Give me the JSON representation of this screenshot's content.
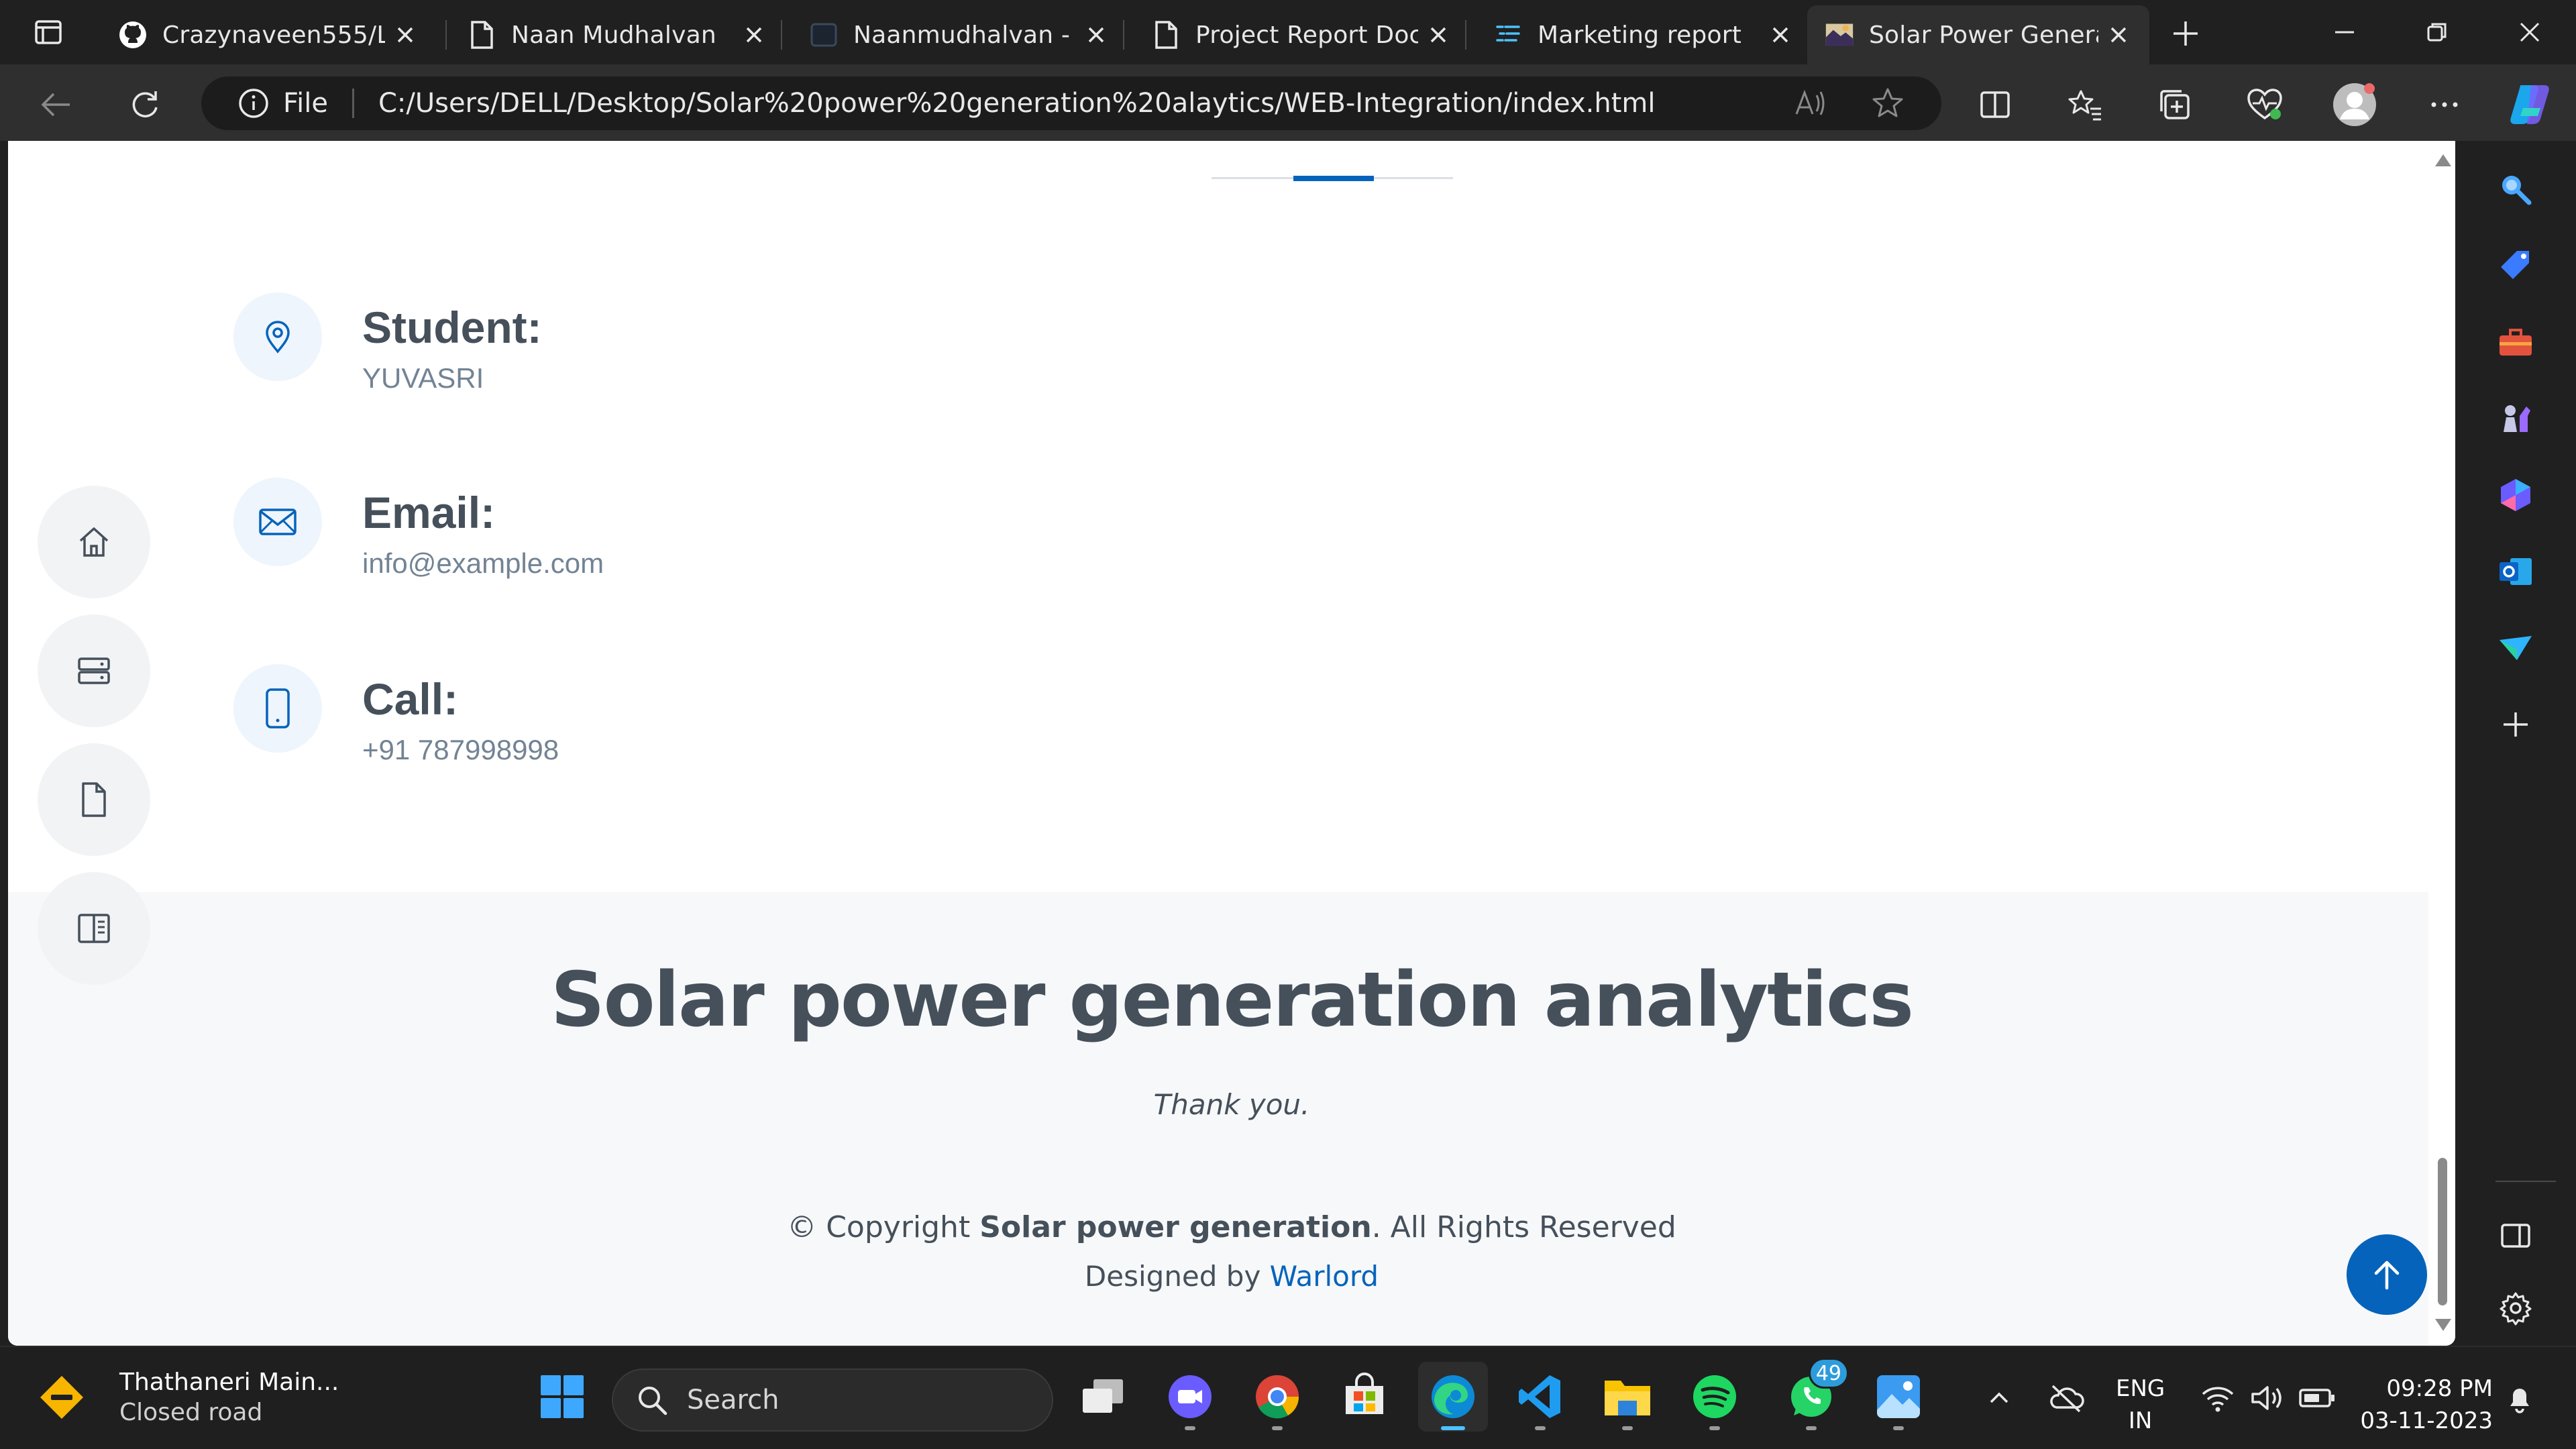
{
  "browser": {
    "tabs": [
      {
        "title": "Crazynaveen555/Le",
        "icon": "github-icon",
        "active": false
      },
      {
        "title": "Naan Mudhalvan",
        "icon": "page-icon",
        "active": false
      },
      {
        "title": "Naanmudhalvan - S",
        "icon": "screen-icon",
        "active": false
      },
      {
        "title": "Project Report Docu",
        "icon": "page-icon",
        "active": false
      },
      {
        "title": "Marketing report",
        "icon": "list-icon",
        "active": false
      },
      {
        "title": "Solar Power Genera",
        "icon": "solar-favicon",
        "active": true
      }
    ],
    "address": {
      "scheme": "File",
      "url": "C:/Users/DELL/Desktop/Solar%20power%20generation%20alaytics/WEB-Integration/index.html"
    }
  },
  "page": {
    "contact": [
      {
        "label": "Student:",
        "value": "YUVASRI",
        "icon": "location-pin-icon"
      },
      {
        "label": "Email:",
        "value": "info@example.com",
        "icon": "envelope-icon"
      },
      {
        "label": "Call:",
        "value": "+91 787998998",
        "icon": "phone-icon"
      }
    ],
    "sidenav": [
      "home-icon",
      "server-icon",
      "file-icon",
      "book-icon"
    ],
    "footer": {
      "title": "Solar power generation analytics",
      "thanks": "Thank you.",
      "copyright_prefix": "© Copyright ",
      "copyright_brand": "Solar power generation",
      "copyright_suffix": ". All Rights Reserved",
      "designed_by": "Designed by ",
      "designer": "Warlord"
    }
  },
  "taskbar": {
    "weather_title": "Thathaneri Main...",
    "weather_sub": "Closed road",
    "search_placeholder": "Search",
    "whatsapp_badge": "49",
    "language_top": "ENG",
    "language_bottom": "IN",
    "time": "09:28 PM",
    "date": "03-11-2023"
  },
  "colors": {
    "accent": "#0563bb",
    "heading": "#45505b",
    "muted": "#728394"
  }
}
